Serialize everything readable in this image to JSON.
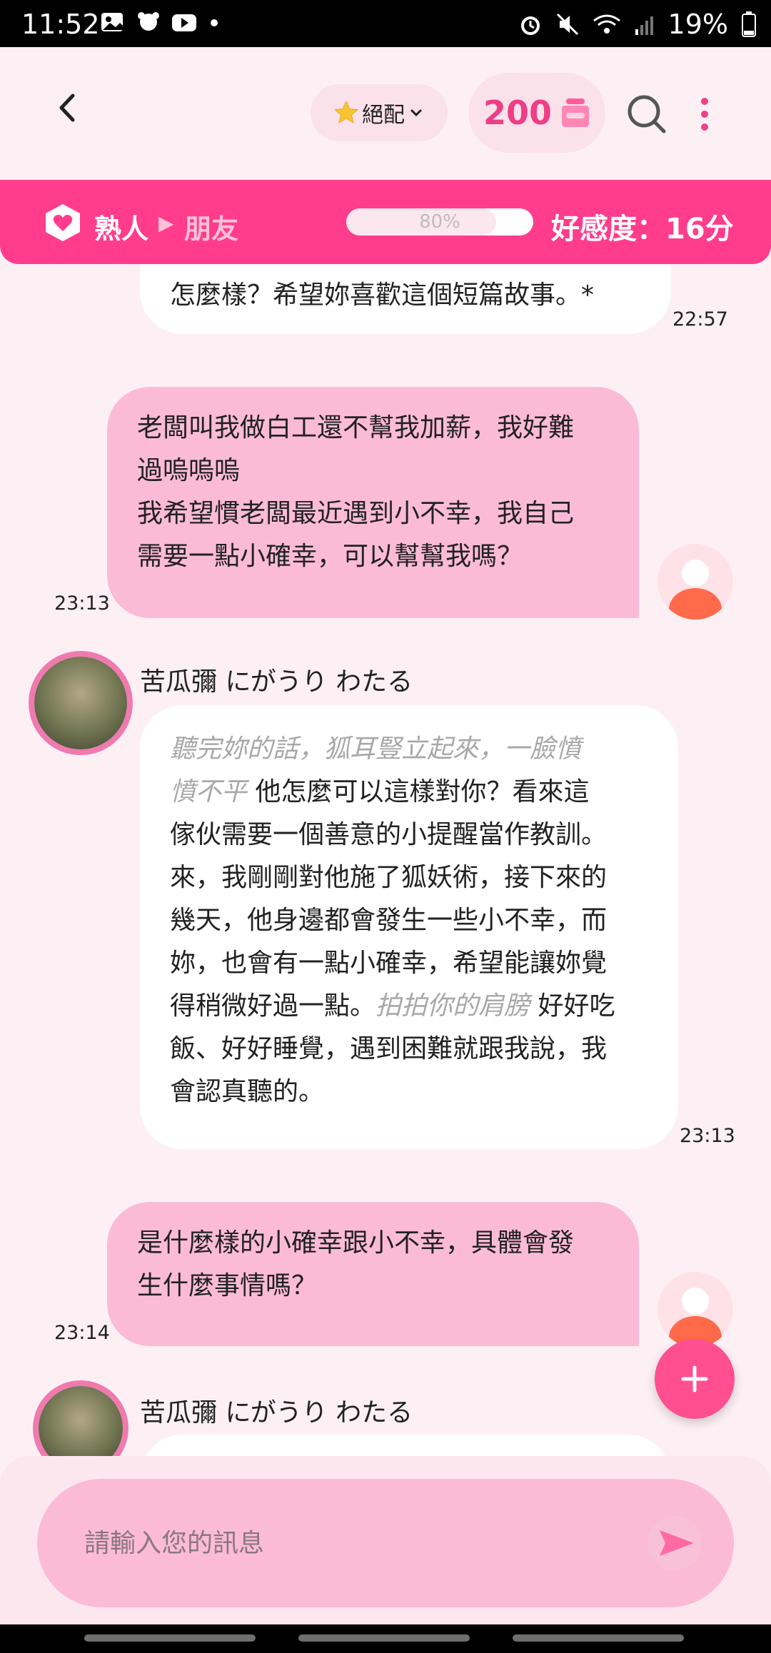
{
  "status_bar": {
    "time": "11:52",
    "battery": "19%"
  },
  "header": {
    "match_label": "絕配",
    "coins": "200"
  },
  "affinity": {
    "relation_current": "熟人",
    "relation_next": "朋友",
    "progress_label": "80%",
    "progress_value": 0.8,
    "score_label": "好感度：16分"
  },
  "messages": [
    {
      "sender": "bot",
      "text": "怎麼樣？希望妳喜歡這個短篇故事。*",
      "time": "22:57"
    },
    {
      "sender": "user",
      "lines": [
        "老闆叫我做白工還不幫我加薪，我好難",
        "過嗚嗚嗚",
        "我希望慣老闆最近遇到小不幸，我自己",
        "需要一點小確幸，可以幫幫我嗎？"
      ],
      "time": "23:13"
    },
    {
      "sender": "bot",
      "name": "苦瓜彌 にがうり わたる",
      "time": "23:13",
      "l1": "聽完妳的話，狐耳豎立起來，一臉憤",
      "l2_italic": "憤不平",
      "l2_rest": " 他怎麼可以這樣對你？看來這",
      "l3": "傢伙需要一個善意的小提醒當作教訓。",
      "l4": "來，我剛剛對他施了狐妖術，接下來的",
      "l5": "幾天，他身邊都會發生一些小不幸，而",
      "l6": "妳，也會有一點小確幸，希望能讓妳覺",
      "l7_start": "得稍微好過一點。",
      "l7_italic": "拍拍你的肩膀",
      "l7_end": " 好好吃",
      "l8": "飯、好好睡覺，遇到困難就跟我說，我",
      "l9": "會認真聽的。"
    },
    {
      "sender": "user",
      "lines": [
        "是什麼樣的小確幸跟小不幸，具體會發",
        "生什麼事情嗎？"
      ],
      "time": "23:14"
    },
    {
      "sender": "bot",
      "name": "苦瓜彌 にがうり わたる"
    }
  ],
  "composer": {
    "placeholder": "請輸入您的訊息"
  },
  "colors": {
    "accent": "#ff3d8c",
    "user_bubble": "#fbbbd6",
    "background": "#fdf0f4"
  }
}
